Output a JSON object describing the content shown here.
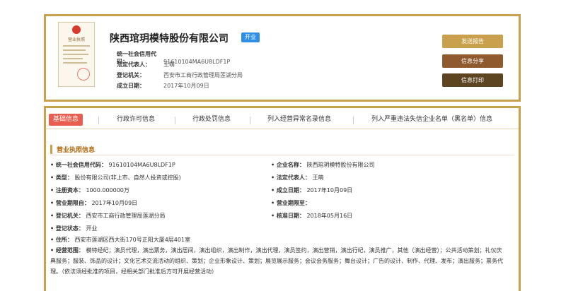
{
  "company": {
    "name": "陕西琯玥模特股份有限公司",
    "status": "开业",
    "license_title": "营业执照",
    "info": [
      {
        "label": "统一社会信用代码：",
        "value": "91610104MA6U8LDF1P"
      },
      {
        "label": "法定代表人：",
        "value": "王萌"
      },
      {
        "label": "登记机关：",
        "value": "西安市工商行政管理局莲湖分局"
      },
      {
        "label": "成立日期：",
        "value": "2017年10月09日"
      }
    ]
  },
  "actions": {
    "report": "发送报告",
    "share": "信息分享",
    "print": "信息打印"
  },
  "tabs": [
    "基础信息",
    "行政许可信息",
    "行政处罚信息",
    "列入经营异常名录信息",
    "列入严重违法失信企业名单（黑名单）信息"
  ],
  "section": {
    "title": "营业执照信息",
    "left": [
      {
        "label": "统一社会信用代码：",
        "value": "91610104MA6U8LDF1P"
      },
      {
        "label": "类型：",
        "value": "股份有限公司(非上市、自然人投资或控股)"
      },
      {
        "label": "注册资本：",
        "value": "1000.000000万"
      },
      {
        "label": "营业期限自：",
        "value": "2017年10月09日"
      },
      {
        "label": "登记机关：",
        "value": "西安市工商行政管理局莲湖分局"
      },
      {
        "label": "登记状态：",
        "value": "开业"
      },
      {
        "label": "住所：",
        "value": "西安市莲湖区西大街170号正阳大厦4层401室"
      }
    ],
    "right": [
      {
        "label": "企业名称：",
        "value": "陕西琯玥模特股份有限公司"
      },
      {
        "label": "法定代表人：",
        "value": "王萌"
      },
      {
        "label": "成立日期：",
        "value": "2017年10月09日"
      },
      {
        "label": "营业期限至：",
        "value": ""
      },
      {
        "label": "核准日期：",
        "value": "2018年05月16日"
      }
    ],
    "scope_label": "经营范围：",
    "scope_value": "模特经纪；演员代理，演出票务，演出居间，演出组织，演出制作，演出代理，演员签约，演出营销，演出行纪，演员推广，其他（演出经营）；公共活动策划；礼仪庆典服务；服装、饰品的设计；文化艺术交流活动的组织、策划；企业形象设计、策划；展览展示服务；会议会务服务；舞台设计；广告的设计、制作、代理、发布；演出服务；票务代理。（依法须经批准的项目，经相关部门批准后方可开展经营活动）"
  }
}
